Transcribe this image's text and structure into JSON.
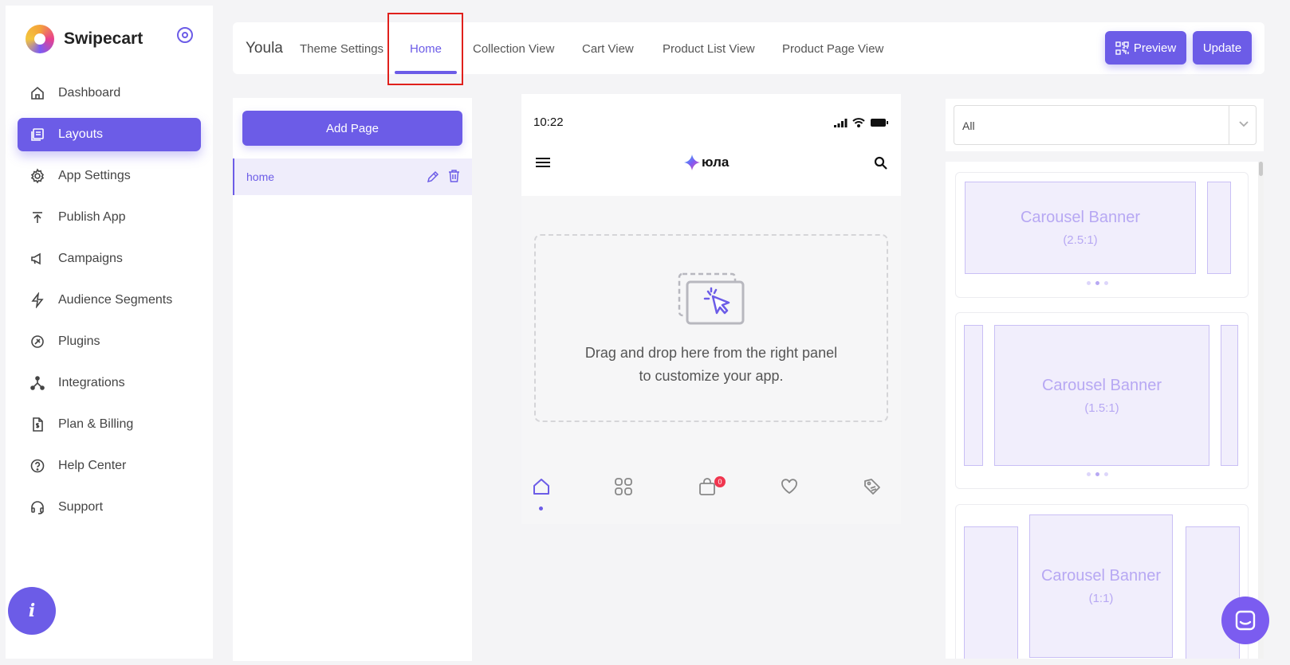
{
  "brand": {
    "name": "Swipecart"
  },
  "sidebar": {
    "items": [
      {
        "label": "Dashboard",
        "icon": "home-icon"
      },
      {
        "label": "Layouts",
        "icon": "layouts-icon"
      },
      {
        "label": "App Settings",
        "icon": "gear-icon"
      },
      {
        "label": "Publish App",
        "icon": "upload-icon"
      },
      {
        "label": "Campaigns",
        "icon": "megaphone-icon"
      },
      {
        "label": "Audience Segments",
        "icon": "bolt-icon"
      },
      {
        "label": "Plugins",
        "icon": "plug-icon"
      },
      {
        "label": "Integrations",
        "icon": "integrations-icon"
      },
      {
        "label": "Plan & Billing",
        "icon": "billing-icon"
      },
      {
        "label": "Help Center",
        "icon": "help-icon"
      },
      {
        "label": "Support",
        "icon": "headset-icon"
      }
    ],
    "active": "Layouts",
    "info_label": "i"
  },
  "topbar": {
    "project": "Youla",
    "tabs": [
      "Theme Settings",
      "Home",
      "Collection View",
      "Cart View",
      "Product List View",
      "Product Page View"
    ],
    "active_tab": "Home",
    "preview_label": "Preview",
    "update_label": "Update"
  },
  "pages": {
    "add_label": "Add Page",
    "items": [
      {
        "name": "home"
      }
    ]
  },
  "phone": {
    "time": "10:22",
    "app_name": "юла",
    "drop_text": "Drag and drop here from the right panel to customize your app.",
    "cart_badge": "0"
  },
  "widgets": {
    "filter_value": "All",
    "items": [
      {
        "title": "Carousel Banner",
        "ratio": "(2.5:1)"
      },
      {
        "title": "Carousel Banner",
        "ratio": "(1.5:1)"
      },
      {
        "title": "Carousel Banner",
        "ratio": "(1:1)"
      }
    ]
  },
  "colors": {
    "accent": "#6c5ce7",
    "badge": "#f0364f",
    "highlight": "#e0201c"
  }
}
